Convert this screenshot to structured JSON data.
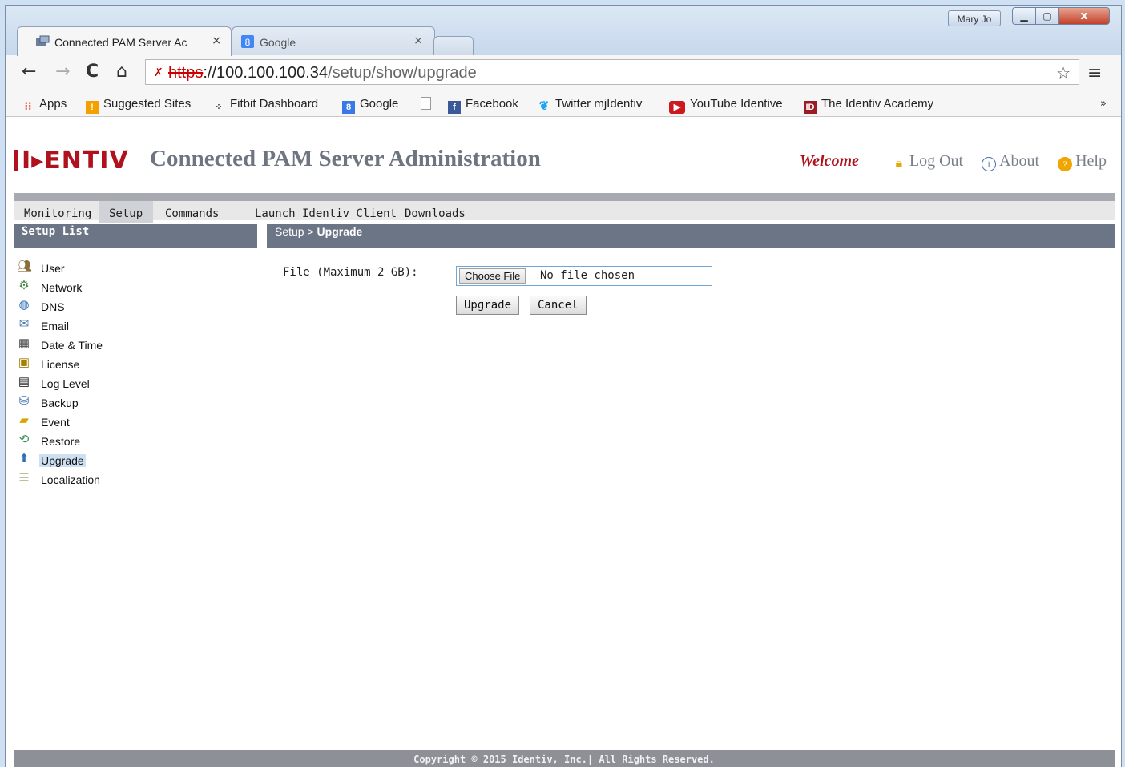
{
  "window": {
    "user_badge": "Mary Jo",
    "close_label": "x"
  },
  "tabs": [
    {
      "label": "Connected PAM Server Ac",
      "close": "×",
      "favicon": "server-favicon"
    },
    {
      "label": "Google",
      "close": "×",
      "favicon": "google-favicon"
    }
  ],
  "toolbar": {
    "url_scheme": "https",
    "url_host": "://100.100.100.34",
    "url_path": "/setup/show/upgrade"
  },
  "bookmarks": [
    {
      "label": "Apps",
      "icon": "apps-grid-icon",
      "color": "#e8453c"
    },
    {
      "label": "Suggested Sites",
      "icon": "suggested-sites-icon",
      "color": "#f4a100"
    },
    {
      "label": "Fitbit Dashboard",
      "icon": "fitbit-icon",
      "color": "#333333"
    },
    {
      "label": "Google",
      "icon": "google-icon",
      "color": "#3b78e7"
    },
    {
      "label": "",
      "icon": "blank-page-icon",
      "color": "#ffffff"
    },
    {
      "label": "Facebook",
      "icon": "facebook-icon",
      "color": "#3b5998"
    },
    {
      "label": "Twitter mjIdentiv",
      "icon": "twitter-icon",
      "color": "#1da1f2"
    },
    {
      "label": "YouTube Identive",
      "icon": "youtube-icon",
      "color": "#cc181e"
    },
    {
      "label": "The Identiv Academy",
      "icon": "identiv-academy-icon",
      "color": "#9b1c23"
    }
  ],
  "header": {
    "logo_text": "I▸ENTIV",
    "title": "Connected PAM Server Administration",
    "welcome": "Welcome",
    "logout": "Log Out",
    "about": "About",
    "help": "Help"
  },
  "nav": {
    "items": [
      "Monitoring",
      "Setup",
      "Commands",
      "Launch Identiv Client",
      "Downloads"
    ],
    "active": "Setup"
  },
  "sidebar": {
    "title": "Setup List",
    "items": [
      {
        "label": "User",
        "icon": "users-icon"
      },
      {
        "label": "Network",
        "icon": "network-icon"
      },
      {
        "label": "DNS",
        "icon": "globe-icon"
      },
      {
        "label": "Email",
        "icon": "email-icon"
      },
      {
        "label": "Date & Time",
        "icon": "calendar-icon"
      },
      {
        "label": "License",
        "icon": "license-icon"
      },
      {
        "label": "Log Level",
        "icon": "log-icon"
      },
      {
        "label": "Backup",
        "icon": "backup-icon"
      },
      {
        "label": "Event",
        "icon": "event-folder-icon"
      },
      {
        "label": "Restore",
        "icon": "restore-icon"
      },
      {
        "label": "Upgrade",
        "icon": "upgrade-icon"
      },
      {
        "label": "Localization",
        "icon": "localization-icon"
      }
    ],
    "active": "Upgrade"
  },
  "main": {
    "breadcrumb_parent": "Setup >",
    "breadcrumb_current": "Upgrade",
    "file_label": "File (Maximum 2 GB):",
    "choose_file": "Choose File",
    "file_status": "No file chosen",
    "upgrade_button": "Upgrade",
    "cancel_button": "Cancel"
  },
  "footer": {
    "copyright": "Copyright © 2015 Identiv, Inc.| All Rights Reserved."
  }
}
